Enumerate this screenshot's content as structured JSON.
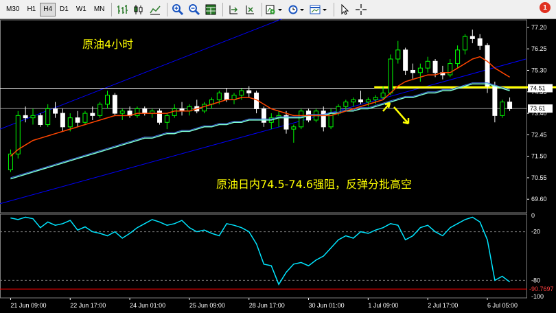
{
  "toolbar": {
    "timeframes": [
      "M30",
      "H1",
      "H4",
      "D1",
      "W1",
      "MN"
    ],
    "active_timeframe": "H4",
    "notification_count": "1",
    "tools": [
      "bar-chart-icon",
      "candlestick-icon",
      "line-chart-icon",
      "zoom-in-icon",
      "zoom-out-icon",
      "tile-windows-icon",
      "chart-shift-icon",
      "autoscroll-icon",
      "indicators-icon",
      "periods-icon",
      "templates-icon",
      "cursor-icon",
      "crosshair-icon",
      "text-icon",
      "arrow-icon",
      "search-icon"
    ]
  },
  "colors": {
    "bull_candle": "#00ff00",
    "bear_candle": "#ffffff",
    "ma_fast": "#ff4500",
    "ma_slow": "#7fffd4",
    "channel": "#0000ff",
    "resistance": "#ffff00",
    "oscillator": "#00e5ff",
    "osc_level": "#ff0000"
  },
  "chart_data": [
    {
      "type": "candlestick",
      "title": "原油4小时",
      "annotation": "原油日内74.5-74.6强阻，反弹分批高空",
      "ylim": [
        69.0,
        77.5
      ],
      "y_ticks": [
        "77.20",
        "76.25",
        "75.30",
        "74.35",
        "73.40",
        "72.45",
        "71.50",
        "70.55",
        "69.60"
      ],
      "x_ticks": [
        "21 Jun 09:00",
        "22 Jun 17:00",
        "24 Jun 01:00",
        "25 Jun 09:00",
        "28 Jun 17:00",
        "30 Jun 01:00",
        "1 Jul 09:00",
        "2 Jul 17:00",
        "6 Jul 05:00"
      ],
      "price_labels": [
        "74.51",
        "73.61"
      ],
      "horizontal_lines": [
        74.51,
        73.61
      ],
      "resistance_zone": [
        74.5,
        74.6
      ],
      "candles": [
        [
          70.9,
          71.8,
          70.8,
          71.6
        ],
        [
          71.6,
          73.5,
          71.4,
          73.3
        ],
        [
          73.3,
          73.7,
          73.0,
          73.2
        ],
        [
          73.2,
          73.6,
          72.9,
          73.3
        ],
        [
          73.3,
          73.4,
          72.8,
          72.9
        ],
        [
          72.9,
          73.8,
          72.8,
          73.6
        ],
        [
          73.6,
          73.9,
          73.2,
          73.4
        ],
        [
          73.4,
          73.6,
          72.6,
          72.8
        ],
        [
          72.8,
          73.4,
          72.6,
          73.2
        ],
        [
          73.2,
          73.5,
          72.8,
          73.0
        ],
        [
          73.0,
          73.5,
          72.9,
          73.4
        ],
        [
          73.4,
          73.7,
          73.1,
          73.3
        ],
        [
          73.3,
          73.9,
          73.2,
          73.8
        ],
        [
          73.8,
          74.4,
          73.6,
          74.2
        ],
        [
          74.2,
          74.3,
          73.3,
          73.4
        ],
        [
          73.4,
          73.6,
          73.1,
          73.5
        ],
        [
          73.5,
          73.7,
          73.2,
          73.3
        ],
        [
          73.3,
          73.7,
          73.2,
          73.6
        ],
        [
          73.6,
          73.7,
          73.3,
          73.4
        ],
        [
          73.4,
          73.6,
          73.2,
          73.5
        ],
        [
          73.5,
          73.6,
          72.9,
          73.0
        ],
        [
          73.0,
          73.4,
          72.7,
          73.3
        ],
        [
          73.3,
          73.8,
          73.2,
          73.6
        ],
        [
          73.6,
          73.9,
          73.3,
          73.5
        ],
        [
          73.5,
          73.8,
          73.3,
          73.7
        ],
        [
          73.7,
          74.0,
          73.4,
          73.5
        ],
        [
          73.5,
          73.9,
          73.4,
          73.8
        ],
        [
          73.8,
          74.1,
          73.6,
          74.0
        ],
        [
          74.0,
          74.4,
          73.8,
          74.3
        ],
        [
          74.3,
          74.5,
          73.9,
          74.0
        ],
        [
          74.0,
          74.3,
          73.8,
          74.2
        ],
        [
          74.2,
          74.5,
          74.0,
          74.4
        ],
        [
          74.4,
          74.6,
          74.1,
          74.3
        ],
        [
          74.3,
          74.4,
          73.4,
          73.6
        ],
        [
          73.6,
          73.7,
          72.8,
          73.0
        ],
        [
          73.0,
          73.4,
          72.7,
          73.2
        ],
        [
          73.2,
          73.5,
          72.8,
          73.3
        ],
        [
          73.3,
          73.5,
          72.5,
          72.7
        ],
        [
          72.7,
          72.9,
          72.1,
          72.8
        ],
        [
          72.8,
          73.6,
          72.7,
          73.5
        ],
        [
          73.5,
          73.6,
          73.0,
          73.1
        ],
        [
          73.1,
          73.6,
          73.0,
          73.5
        ],
        [
          73.5,
          73.7,
          72.6,
          72.8
        ],
        [
          72.8,
          73.6,
          72.7,
          73.4
        ],
        [
          73.4,
          73.8,
          73.3,
          73.7
        ],
        [
          73.7,
          74.0,
          73.5,
          73.9
        ],
        [
          73.9,
          74.1,
          73.7,
          74.0
        ],
        [
          74.0,
          74.4,
          73.8,
          73.9
        ],
        [
          73.9,
          74.1,
          73.7,
          74.0
        ],
        [
          74.0,
          74.2,
          73.8,
          74.1
        ],
        [
          74.1,
          74.6,
          74.0,
          74.3
        ],
        [
          74.3,
          76.0,
          74.2,
          75.8
        ],
        [
          75.8,
          76.6,
          75.6,
          76.2
        ],
        [
          76.2,
          76.3,
          75.1,
          75.3
        ],
        [
          75.3,
          75.6,
          74.9,
          75.2
        ],
        [
          75.2,
          75.6,
          74.8,
          75.4
        ],
        [
          75.4,
          75.9,
          75.2,
          75.7
        ],
        [
          75.7,
          75.8,
          75.0,
          75.2
        ],
        [
          75.2,
          75.5,
          74.9,
          75.1
        ],
        [
          75.1,
          75.8,
          75.0,
          75.6
        ],
        [
          75.6,
          76.4,
          75.4,
          76.2
        ],
        [
          76.2,
          76.9,
          76.0,
          76.8
        ],
        [
          76.8,
          77.1,
          76.5,
          76.7
        ],
        [
          76.7,
          76.9,
          76.2,
          76.4
        ],
        [
          76.4,
          76.5,
          74.3,
          74.6
        ],
        [
          74.6,
          74.8,
          73.0,
          73.3
        ],
        [
          73.3,
          74.0,
          73.2,
          73.9
        ],
        [
          73.9,
          74.1,
          73.5,
          73.6
        ]
      ],
      "ma_fast": [
        71.5,
        71.8,
        72.0,
        72.2,
        72.3,
        72.4,
        72.5,
        72.6,
        72.7,
        72.8,
        72.9,
        73.0,
        73.1,
        73.2,
        73.3,
        73.3,
        73.3,
        73.4,
        73.4,
        73.4,
        73.4,
        73.4,
        73.5,
        73.5,
        73.5,
        73.6,
        73.7,
        73.8,
        73.9,
        74.0,
        74.0,
        74.1,
        74.1,
        74.0,
        73.8,
        73.6,
        73.5,
        73.4,
        73.3,
        73.3,
        73.3,
        73.3,
        73.3,
        73.3,
        73.4,
        73.5,
        73.6,
        73.7,
        73.8,
        73.9,
        74.0,
        74.3,
        74.6,
        74.8,
        74.9,
        75.0,
        75.1,
        75.1,
        75.2,
        75.2,
        75.4,
        75.6,
        75.8,
        75.9,
        75.7,
        75.4,
        75.2,
        75.0
      ],
      "ma_slow": [
        70.5,
        70.6,
        70.7,
        70.8,
        70.9,
        71.0,
        71.1,
        71.2,
        71.3,
        71.4,
        71.5,
        71.6,
        71.7,
        71.8,
        71.9,
        72.0,
        72.1,
        72.2,
        72.3,
        72.3,
        72.4,
        72.5,
        72.5,
        72.6,
        72.6,
        72.7,
        72.8,
        72.8,
        72.9,
        72.9,
        73.0,
        73.0,
        73.1,
        73.1,
        73.1,
        73.1,
        73.2,
        73.2,
        73.2,
        73.2,
        73.3,
        73.3,
        73.3,
        73.4,
        73.4,
        73.5,
        73.5,
        73.6,
        73.6,
        73.7,
        73.8,
        73.9,
        74.0,
        74.1,
        74.1,
        74.2,
        74.3,
        74.3,
        74.4,
        74.4,
        74.5,
        74.6,
        74.7,
        74.7,
        74.7,
        74.6,
        74.5,
        74.4
      ]
    },
    {
      "type": "line",
      "title": "",
      "ylim": [
        -100,
        0
      ],
      "y_ticks": [
        "0",
        "-20",
        "-80",
        "-100"
      ],
      "level_label": "-90.7697",
      "levels": [
        -20,
        -80
      ],
      "values": [
        -3,
        -5,
        -2,
        -4,
        -15,
        -8,
        -12,
        -10,
        -6,
        -18,
        -14,
        -20,
        -22,
        -25,
        -20,
        -28,
        -22,
        -15,
        -10,
        -5,
        -8,
        -12,
        -10,
        -6,
        -15,
        -20,
        -18,
        -22,
        -25,
        -10,
        -12,
        -15,
        -20,
        -35,
        -60,
        -62,
        -85,
        -70,
        -60,
        -58,
        -62,
        -55,
        -50,
        -40,
        -30,
        -25,
        -28,
        -20,
        -22,
        -18,
        -15,
        -10,
        -12,
        -30,
        -25,
        -15,
        -12,
        -20,
        -25,
        -15,
        -10,
        -5,
        -2,
        -8,
        -30,
        -80,
        -75,
        -82
      ]
    }
  ]
}
